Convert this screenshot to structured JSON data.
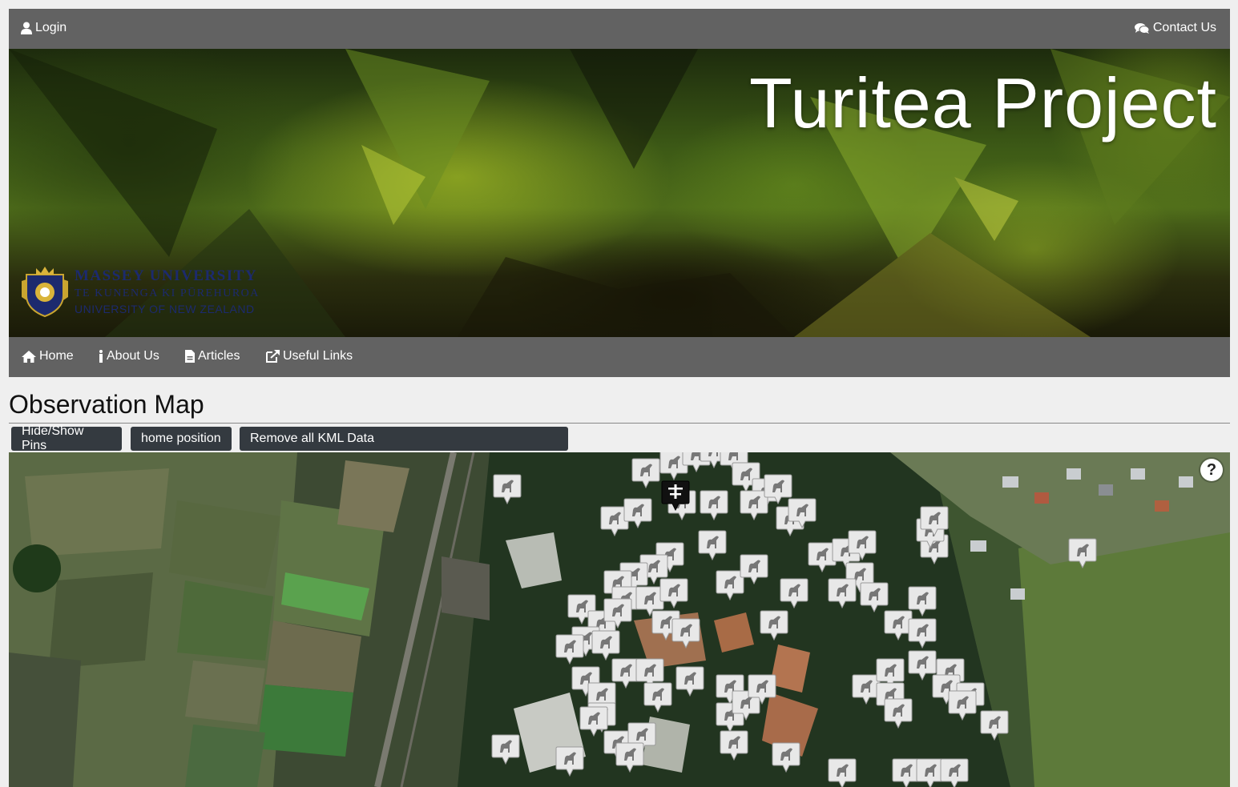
{
  "topbar": {
    "login_label": "Login",
    "contact_label": "Contact Us"
  },
  "banner": {
    "title": "Turitea Project",
    "logo": {
      "line1": "MASSEY UNIVERSITY",
      "line2": "TE KUNENGA KI PŪREHUROA",
      "line3": "UNIVERSITY OF NEW ZEALAND"
    }
  },
  "nav": {
    "items": [
      {
        "label": "Home",
        "icon": "home-icon"
      },
      {
        "label": "About Us",
        "icon": "info-icon"
      },
      {
        "label": "Articles",
        "icon": "file-icon"
      },
      {
        "label": "Useful Links",
        "icon": "external-link-icon"
      }
    ]
  },
  "page": {
    "heading": "Observation Map"
  },
  "toolbar": {
    "hide_show_pins": "Hide/Show Pins",
    "home_position": "home position",
    "remove_kml": "Remove all KML Data"
  },
  "map": {
    "help_label": "?",
    "pin_icon": "dinosaur-pin-icon",
    "selected_pin_icon": "selected-pin-icon"
  }
}
